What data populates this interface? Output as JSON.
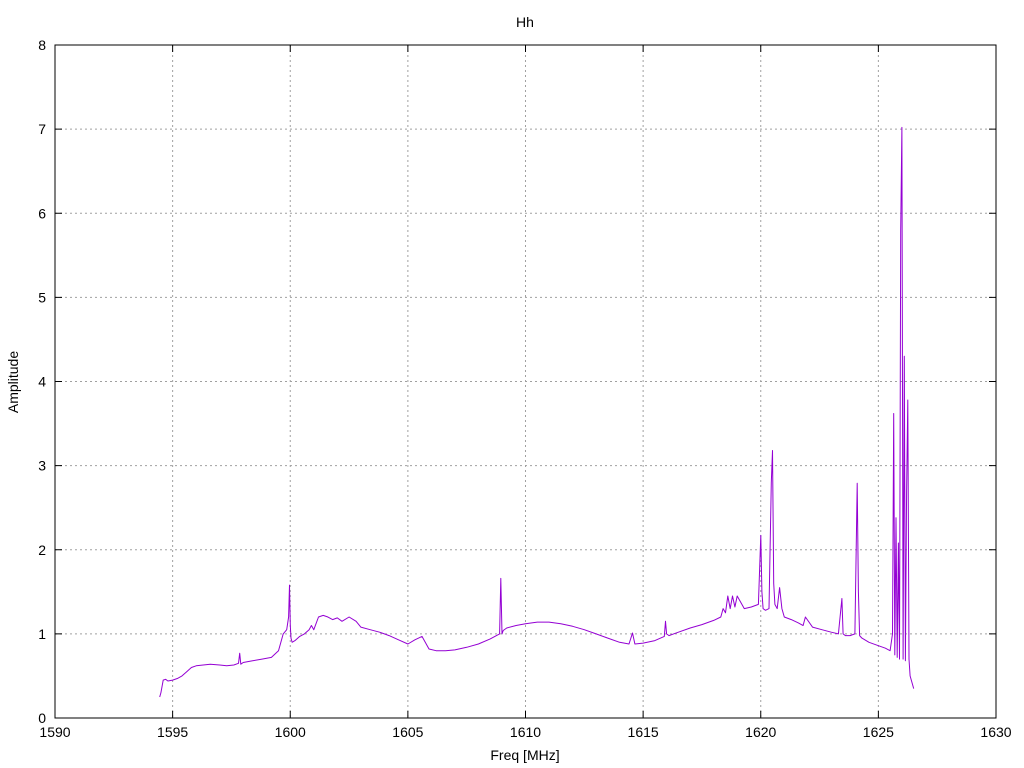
{
  "chart_data": {
    "type": "line",
    "title": "Hh",
    "xlabel": "Freq [MHz]",
    "ylabel": "Amplitude",
    "xlim": [
      1590,
      1630
    ],
    "ylim": [
      0,
      8
    ],
    "xticks": [
      1590,
      1595,
      1600,
      1605,
      1610,
      1615,
      1620,
      1625,
      1630
    ],
    "yticks": [
      0,
      1,
      2,
      3,
      4,
      5,
      6,
      7,
      8
    ],
    "grid": true,
    "legend": "none",
    "series": [
      {
        "color": "#9400d3",
        "x": [
          1594.45,
          1594.5,
          1594.6,
          1594.7,
          1594.8,
          1595.0,
          1595.2,
          1595.4,
          1595.6,
          1595.8,
          1596.0,
          1596.3,
          1596.6,
          1597.0,
          1597.3,
          1597.6,
          1597.8,
          1597.85,
          1597.9,
          1598.0,
          1598.4,
          1598.8,
          1599.2,
          1599.5,
          1599.7,
          1599.85,
          1599.93,
          1599.97,
          1600.0,
          1600.03,
          1600.08,
          1600.2,
          1600.4,
          1600.6,
          1600.8,
          1600.9,
          1601.0,
          1601.2,
          1601.4,
          1601.6,
          1601.8,
          1602.0,
          1602.2,
          1602.5,
          1602.8,
          1603.0,
          1603.4,
          1603.8,
          1604.2,
          1604.6,
          1605.0,
          1605.3,
          1605.6,
          1605.9,
          1606.2,
          1606.6,
          1607.0,
          1607.5,
          1608.0,
          1608.5,
          1608.9,
          1608.95,
          1609.0,
          1609.05,
          1609.2,
          1609.6,
          1610.0,
          1610.5,
          1611.0,
          1611.5,
          1612.0,
          1612.5,
          1613.0,
          1613.5,
          1614.0,
          1614.4,
          1614.55,
          1614.65,
          1615.0,
          1615.5,
          1615.9,
          1615.95,
          1616.0,
          1616.1,
          1616.5,
          1617.0,
          1617.5,
          1618.0,
          1618.3,
          1618.4,
          1618.5,
          1618.6,
          1618.7,
          1618.8,
          1618.9,
          1619.0,
          1619.3,
          1619.6,
          1619.9,
          1620.0,
          1620.05,
          1620.1,
          1620.2,
          1620.35,
          1620.45,
          1620.5,
          1620.55,
          1620.6,
          1620.7,
          1620.8,
          1620.9,
          1621.0,
          1621.3,
          1621.6,
          1621.8,
          1621.9,
          1622.2,
          1622.6,
          1623.0,
          1623.3,
          1623.45,
          1623.5,
          1623.6,
          1623.8,
          1624.0,
          1624.1,
          1624.15,
          1624.2,
          1624.3,
          1624.6,
          1625.0,
          1625.3,
          1625.5,
          1625.6,
          1625.65,
          1625.7,
          1625.75,
          1625.8,
          1625.85,
          1625.9,
          1625.95,
          1626.0,
          1626.05,
          1626.1,
          1626.15,
          1626.2,
          1626.25,
          1626.3,
          1626.35,
          1626.4,
          1626.5
        ],
        "y": [
          0.25,
          0.3,
          0.45,
          0.46,
          0.44,
          0.45,
          0.47,
          0.5,
          0.55,
          0.6,
          0.62,
          0.63,
          0.64,
          0.63,
          0.62,
          0.63,
          0.65,
          0.77,
          0.64,
          0.66,
          0.68,
          0.7,
          0.72,
          0.8,
          1.0,
          1.05,
          1.2,
          1.58,
          1.1,
          0.95,
          0.9,
          0.92,
          0.97,
          1.0,
          1.05,
          1.1,
          1.05,
          1.2,
          1.22,
          1.2,
          1.17,
          1.19,
          1.15,
          1.2,
          1.15,
          1.08,
          1.05,
          1.02,
          0.98,
          0.93,
          0.88,
          0.93,
          0.97,
          0.82,
          0.8,
          0.8,
          0.81,
          0.84,
          0.88,
          0.94,
          1.0,
          1.66,
          1.0,
          1.04,
          1.07,
          1.1,
          1.12,
          1.14,
          1.14,
          1.12,
          1.09,
          1.05,
          1.0,
          0.95,
          0.9,
          0.88,
          1.01,
          0.88,
          0.89,
          0.92,
          0.97,
          1.15,
          1.0,
          0.98,
          1.02,
          1.07,
          1.11,
          1.16,
          1.2,
          1.3,
          1.25,
          1.45,
          1.3,
          1.45,
          1.32,
          1.45,
          1.3,
          1.32,
          1.35,
          2.17,
          1.5,
          1.3,
          1.28,
          1.3,
          2.8,
          3.18,
          1.6,
          1.35,
          1.3,
          1.55,
          1.3,
          1.2,
          1.17,
          1.13,
          1.1,
          1.2,
          1.08,
          1.05,
          1.02,
          1.0,
          1.42,
          1.0,
          0.98,
          0.98,
          1.0,
          2.79,
          1.5,
          0.98,
          0.95,
          0.9,
          0.86,
          0.83,
          0.8,
          1.0,
          3.62,
          0.75,
          2.38,
          0.72,
          2.08,
          0.7,
          5.8,
          7.02,
          0.7,
          4.3,
          0.68,
          2.7,
          3.78,
          0.7,
          0.5,
          0.45,
          0.35
        ]
      }
    ]
  }
}
